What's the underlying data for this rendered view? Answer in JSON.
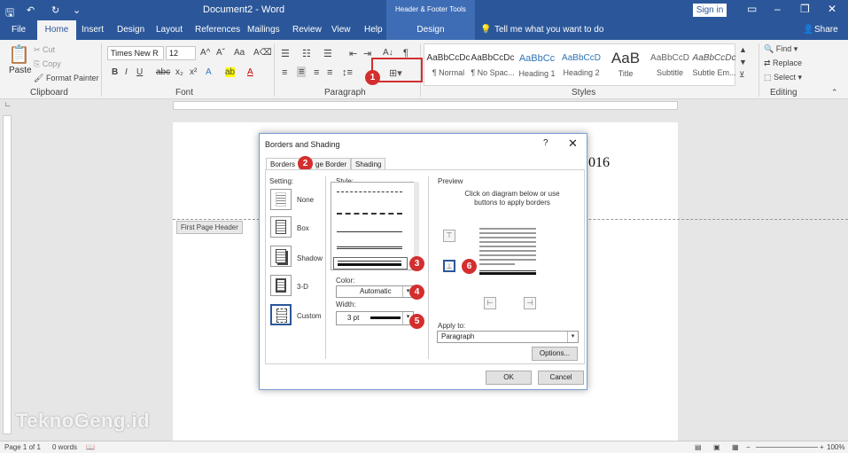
{
  "window": {
    "title": "Document2 - Word",
    "contextual_tools": "Header & Footer Tools",
    "sign_in": "Sign in"
  },
  "tabs": {
    "file": "File",
    "home": "Home",
    "insert": "Insert",
    "design": "Design",
    "layout": "Layout",
    "references": "References",
    "mailings": "Mailings",
    "review": "Review",
    "view": "View",
    "help": "Help",
    "design_ctx": "Design",
    "tell_me": "Tell me what you want to do",
    "share": "Share"
  },
  "ribbon": {
    "clipboard": {
      "label": "Clipboard",
      "paste": "Paste",
      "cut": "Cut",
      "copy": "Copy",
      "format_painter": "Format Painter"
    },
    "font": {
      "label": "Font",
      "font_name": "Times New R",
      "font_size": "12"
    },
    "paragraph": {
      "label": "Paragraph"
    },
    "styles": {
      "label": "Styles",
      "items": [
        {
          "preview": "AaBbCcDc",
          "name": "¶ Normal"
        },
        {
          "preview": "AaBbCcDc",
          "name": "¶ No Spac..."
        },
        {
          "preview": "AaBbCc",
          "name": "Heading 1"
        },
        {
          "preview": "AaBbCcD",
          "name": "Heading 2"
        },
        {
          "preview": "AaB",
          "name": "Title"
        },
        {
          "preview": "AaBbCcD",
          "name": "Subtitle"
        },
        {
          "preview": "AaBbCcDc",
          "name": "Subtle Em..."
        }
      ]
    },
    "editing": {
      "label": "Editing",
      "find": "Find",
      "replace": "Replace",
      "select": "Select"
    }
  },
  "document": {
    "header_tag": "First Page Header",
    "visible_text": "016"
  },
  "dialog": {
    "title": "Borders and Shading",
    "help": "?",
    "tabs": [
      "Borders",
      "ge Border",
      "Shading"
    ],
    "setting_label": "Setting:",
    "settings": [
      "None",
      "Box",
      "Shadow",
      "3-D",
      "Custom"
    ],
    "style_label": "Style:",
    "color_label": "Color:",
    "color_value": "Automatic",
    "width_label": "Width:",
    "width_value": "3 pt",
    "preview_label": "Preview",
    "preview_hint": "Click on diagram below or use buttons to apply borders",
    "apply_to_label": "Apply to:",
    "apply_to_value": "Paragraph",
    "options": "Options...",
    "ok": "OK",
    "cancel": "Cancel"
  },
  "callouts": [
    "1",
    "2",
    "3",
    "4",
    "5",
    "6"
  ],
  "status": {
    "page": "Page 1 of 1",
    "words": "0 words",
    "zoom": "100%"
  },
  "watermark": "TeknoGeng.id",
  "colors": {
    "accent": "#2b579a",
    "callout": "#d32f2f"
  }
}
